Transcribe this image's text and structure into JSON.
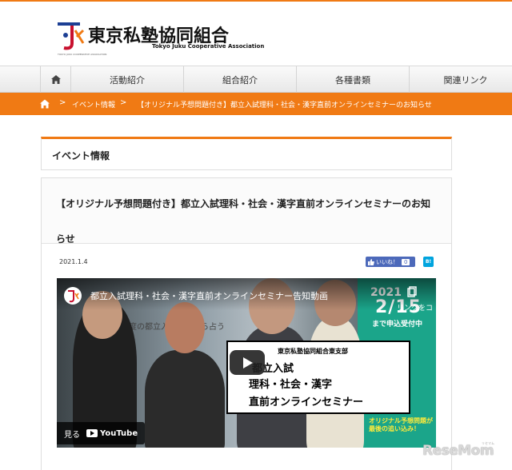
{
  "site": {
    "name": "東京私塾協同組合",
    "name_en": "Tokyo Juku Cooperative Association",
    "logo_small": "TOKYO JUKU COOPERATIVE ASSOCIATION",
    "accent_color": "#f07a14"
  },
  "nav": {
    "home_icon": "home-icon",
    "items": [
      {
        "label": "活動紹介"
      },
      {
        "label": "組合紹介"
      },
      {
        "label": "各種書類"
      },
      {
        "label": "関連リンク"
      }
    ]
  },
  "breadcrumb": {
    "home_icon": "home-icon",
    "separator": ">",
    "items": [
      {
        "label": "イベント情報"
      },
      {
        "label": "【オリジナル予想問題付き】都立入試理科・社会・漢字直前オンラインセミナーのお知らせ"
      }
    ]
  },
  "section": {
    "heading": "イベント情報"
  },
  "post": {
    "title": "【オリジナル予想問題付き】都立入試理科・社会・漢字直前オンラインセミナーのお知らせ",
    "date": "2021.1.4",
    "like_label": "いいね！",
    "like_count": "0",
    "hatena_label": "B!"
  },
  "video": {
    "title": "都立入試理科・社会・漢字直前オンラインセミナー告知動画",
    "share_label": "リンクをコ",
    "whiteboard_text": "「今年度の都立入試問題から占う",
    "date_line1": "2021",
    "date_line2": "2/15",
    "deadline": "まで申込受付中",
    "card_sub": "東京私塾協同組合東支部",
    "card_l1": "都立入試",
    "card_l2": "理科・社会・漢字",
    "card_l3": "直前オンラインセミナー",
    "watch_label": "見る",
    "youtube_label": "YouTube",
    "promo_text": "オリジナル予想問題が 最後の追い込み！"
  },
  "watermark": {
    "text": "ReseMom",
    "kana": "リセマム"
  }
}
